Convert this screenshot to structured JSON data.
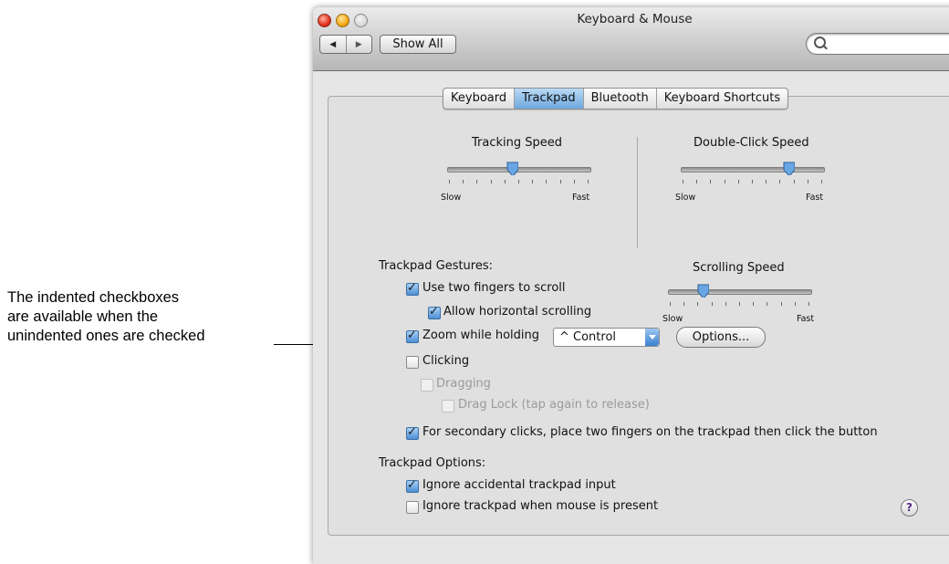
{
  "callout": {
    "line1": "The indented checkboxes",
    "line2": "are available when the",
    "line3": "unindented ones are checked"
  },
  "window": {
    "title": "Keyboard & Mouse",
    "back_icon": "back-arrow-icon",
    "forward_icon": "forward-arrow-icon",
    "show_all_label": "Show All",
    "search_placeholder": ""
  },
  "tabs": [
    {
      "label": "Keyboard",
      "selected": false
    },
    {
      "label": "Trackpad",
      "selected": true
    },
    {
      "label": "Bluetooth",
      "selected": false
    },
    {
      "label": "Keyboard Shortcuts",
      "selected": false
    }
  ],
  "sliders": {
    "tracking": {
      "title": "Tracking Speed",
      "min_label": "Slow",
      "max_label": "Fast",
      "value": 0.45
    },
    "double_click": {
      "title": "Double-Click Speed",
      "min_label": "Slow",
      "max_label": "Fast",
      "value": 0.78
    },
    "scrolling": {
      "title": "Scrolling Speed",
      "min_label": "Slow",
      "max_label": "Fast",
      "value": 0.22
    }
  },
  "gestures": {
    "heading": "Trackpad Gestures:",
    "two_fingers_scroll": {
      "label": "Use two fingers to scroll",
      "checked": true
    },
    "horizontal_scroll": {
      "label": "Allow horizontal scrolling",
      "checked": true
    },
    "zoom": {
      "label": "Zoom while holding",
      "checked": true
    },
    "zoom_modifier": "^ Control",
    "options_button": "Options...",
    "clicking": {
      "label": "Clicking",
      "checked": false
    },
    "dragging": {
      "label": "Dragging",
      "checked": false,
      "enabled": false
    },
    "drag_lock": {
      "label": "Drag Lock (tap again to release)",
      "checked": false,
      "enabled": false
    },
    "secondary_click": {
      "label": "For secondary clicks, place two fingers on the trackpad then click the button",
      "checked": true
    }
  },
  "options": {
    "heading": "Trackpad Options:",
    "ignore_accidental": {
      "label": "Ignore accidental trackpad input",
      "checked": true
    },
    "ignore_when_mouse": {
      "label": "Ignore trackpad when mouse is present",
      "checked": false
    }
  },
  "help_label": "?"
}
